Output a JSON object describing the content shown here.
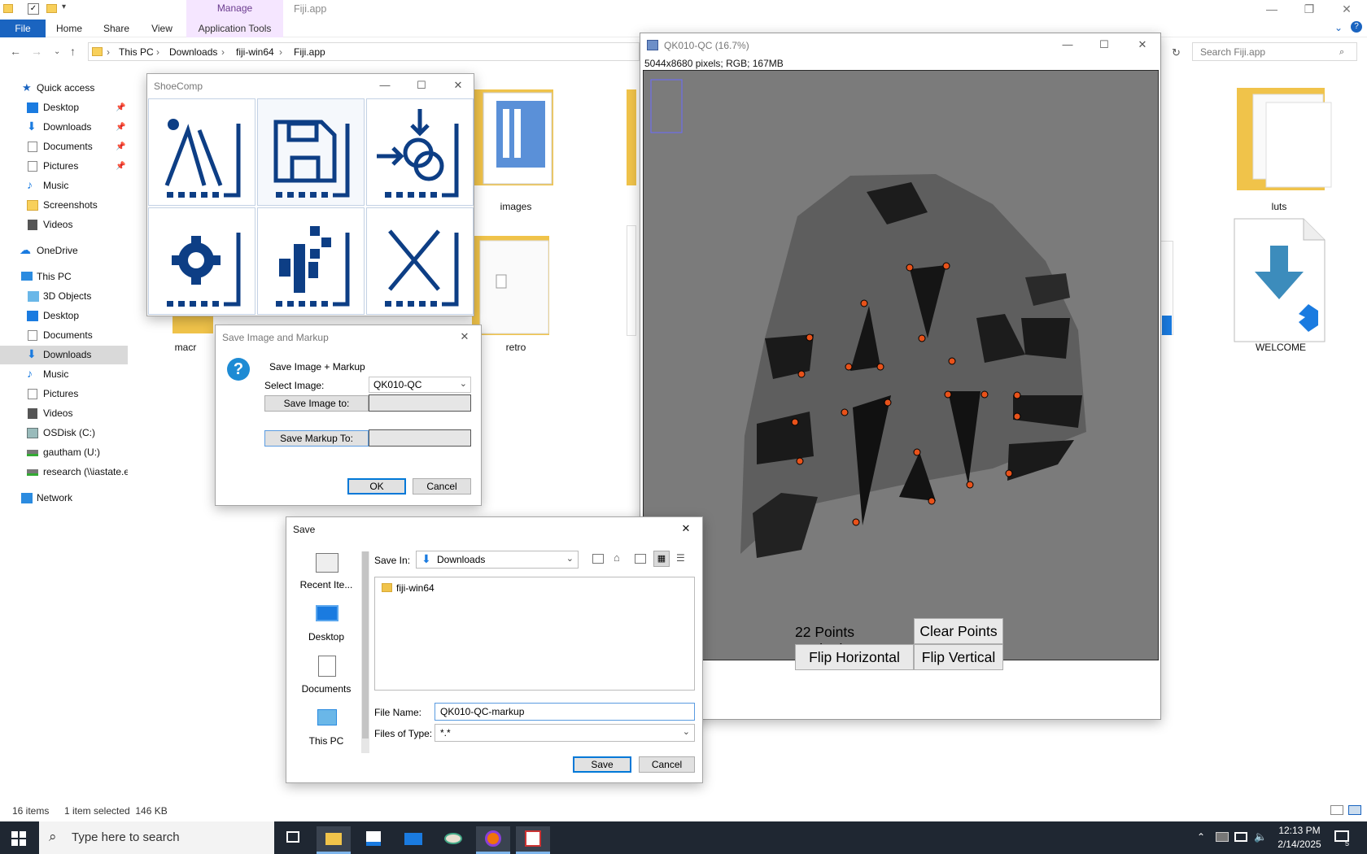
{
  "explorer": {
    "window_title": "Fiji.app",
    "context_tab": "Manage",
    "ribbon_tabs": [
      "File",
      "Home",
      "Share",
      "View",
      "Application Tools"
    ],
    "breadcrumb": [
      "This PC",
      "Downloads",
      "fiji-win64",
      "Fiji.app"
    ],
    "search_placeholder": "Search Fiji.app",
    "nav": {
      "quick_access": "Quick access",
      "quick_items": [
        "Desktop",
        "Downloads",
        "Documents",
        "Pictures",
        "Music",
        "Screenshots",
        "Videos"
      ],
      "onedrive": "OneDrive",
      "this_pc": "This PC",
      "pc_items": [
        "3D Objects",
        "Desktop",
        "Documents",
        "Downloads",
        "Music",
        "Pictures",
        "Videos",
        "OSDisk (C:)",
        "gautham (U:)",
        "research (\\\\iastate.e"
      ],
      "network": "Network"
    },
    "files": [
      "images",
      "luts",
      "macr",
      "retro",
      "WELCOME"
    ],
    "status": {
      "items": "16 items",
      "selected": "1 item selected  146 KB"
    }
  },
  "shoecomp": {
    "title": "ShoeComp",
    "tiles": [
      "open-image-icon",
      "save-icon",
      "compare-icon",
      "settings-icon",
      "info-icon",
      "close-icon"
    ]
  },
  "fiji_image": {
    "title": "QK010-QC (16.7%)",
    "info": "5044x8680 pixels; RGB; 167MB",
    "points_label": "22 Points Marked",
    "clear_button": "Clear Points",
    "flip_h": "Flip Horizontal",
    "flip_v": "Flip Vertical"
  },
  "save_markup_dialog": {
    "title": "Save Image and Markup",
    "heading": "Save Image + Markup",
    "select_image_label": "Select Image:",
    "select_image_value": "QK010-QC",
    "save_image_button": "Save Image to:",
    "save_markup_button": "Save Markup To:",
    "ok": "OK",
    "cancel": "Cancel"
  },
  "save_dialog": {
    "title": "Save",
    "places": [
      "Recent Ite...",
      "Desktop",
      "Documents",
      "This PC"
    ],
    "save_in_label": "Save In:",
    "save_in_value": "Downloads",
    "folder_entry": "fiji-win64",
    "file_name_label": "File Name:",
    "file_name_value": "QK010-QC-markup",
    "file_type_label": "Files of Type:",
    "file_type_value": "*.*",
    "save": "Save",
    "cancel": "Cancel"
  },
  "taskbar": {
    "search_placeholder": "Type here to search",
    "time": "12:13 PM",
    "date": "2/14/2025",
    "notification_count": "5"
  },
  "colors": {
    "accent": "#1a64c0",
    "shoecomp_blue": "#0d3e85",
    "marker": "#e8521a",
    "manage_tab": "#f5e6ff"
  }
}
